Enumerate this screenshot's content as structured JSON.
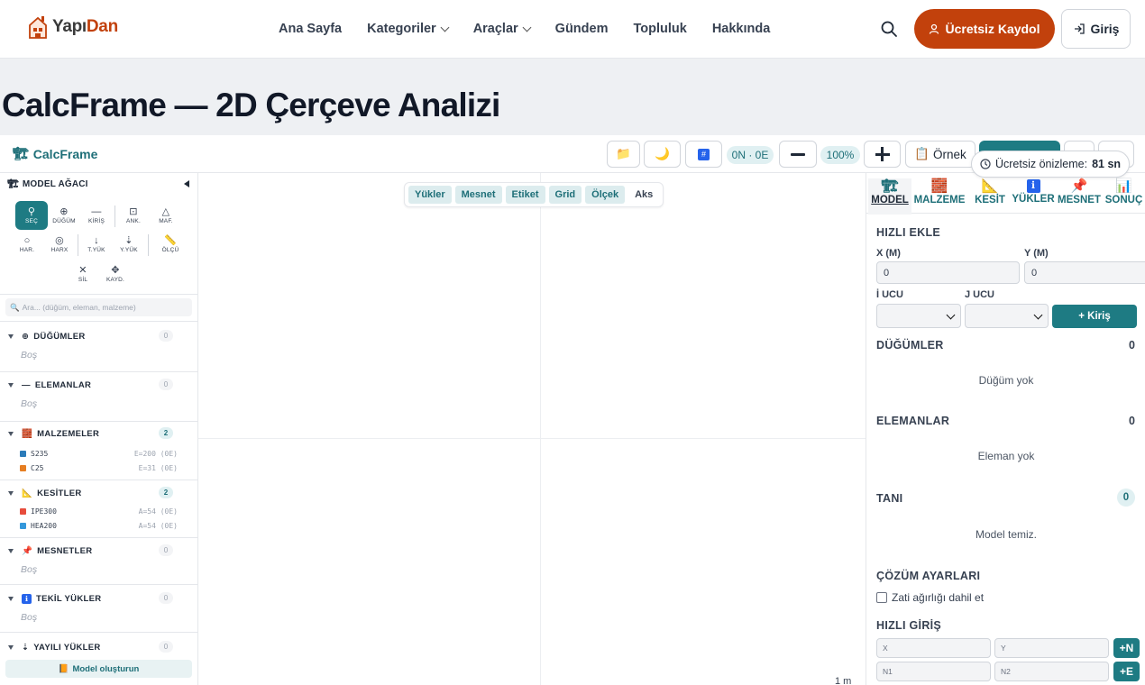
{
  "brand": {
    "name_a": "Yapı",
    "name_b": "Dan"
  },
  "nav": {
    "items": [
      "Ana Sayfa",
      "Kategoriler",
      "Araçlar",
      "Gündem",
      "Topluluk",
      "Hakkında"
    ],
    "register": "Ücretsiz Kaydol",
    "login": "Giriş"
  },
  "page": {
    "title": "CalcFrame — 2D Çerçeve Analizi"
  },
  "toolbar": {
    "app_name": "CalcFrame",
    "counts": "0N · 0E",
    "zoom": "100%",
    "example": "Örnek",
    "preview": "Ücretsiz önizleme:",
    "preview_time": "81 sn"
  },
  "left": {
    "title": "MODEL AĞACI",
    "tools_row1": [
      {
        "label": "SEÇ",
        "icon": "⚲"
      },
      {
        "label": "DÜĞÜM",
        "icon": "⊕"
      },
      {
        "label": "KİRİŞ",
        "icon": "—"
      },
      {
        "label": "ANK.",
        "icon": "⊡"
      },
      {
        "label": "MAF.",
        "icon": "△"
      }
    ],
    "tools_row2": [
      {
        "label": "HAR.",
        "icon": "○"
      },
      {
        "label": "HARX",
        "icon": "◎"
      },
      {
        "label": "T.YÜK",
        "icon": "↓"
      },
      {
        "label": "Y.YÜK",
        "icon": "⇣"
      },
      {
        "label": "ÖLÇÜ",
        "icon": "📏"
      }
    ],
    "tools_row3": [
      {
        "label": "SİL",
        "icon": "✕"
      },
      {
        "label": "KAYD.",
        "icon": "✥"
      }
    ],
    "search_placeholder": "Ara... (düğüm, eleman, malzeme)",
    "sections": [
      {
        "title": "DÜĞÜMLER",
        "icon": "⊕",
        "count": "0",
        "empty": "Boş"
      },
      {
        "title": "ELEMANLAR",
        "icon": "—",
        "count": "0",
        "empty": "Boş"
      },
      {
        "title": "MALZEMELER",
        "icon": "🧱",
        "count": "2",
        "rows": [
          {
            "name": "S235",
            "meta": "E=200 (0E)",
            "color": "#2b7bb9"
          },
          {
            "name": "C25",
            "meta": "E=31 (0E)",
            "color": "#e67e22"
          }
        ]
      },
      {
        "title": "KESİTLER",
        "icon": "📐",
        "count": "2",
        "rows": [
          {
            "name": "IPE300",
            "meta": "A=54 (0E)",
            "color": "#e74c3c"
          },
          {
            "name": "HEA200",
            "meta": "A=54 (0E)",
            "color": "#3498db"
          }
        ]
      },
      {
        "title": "MESNETLER",
        "icon": "📌",
        "count": "0",
        "empty": "Boş"
      },
      {
        "title": "TEKİL YÜKLER",
        "icon": "ℹ",
        "count": "0",
        "empty": "Boş"
      },
      {
        "title": "YAYILI YÜKLER",
        "icon": "⇣",
        "count": "0"
      }
    ],
    "model_button": "Model oluşturun"
  },
  "canvas": {
    "layers": [
      {
        "label": "Yükler",
        "on": true
      },
      {
        "label": "Mesnet",
        "on": true
      },
      {
        "label": "Etiket",
        "on": true
      },
      {
        "label": "Grid",
        "on": true
      },
      {
        "label": "Ölçek",
        "on": true
      },
      {
        "label": "Aks",
        "on": false
      }
    ],
    "scale": "1 m"
  },
  "right": {
    "tabs": [
      {
        "label": "MODEL",
        "icon": "🏗"
      },
      {
        "label": "MALZEME",
        "icon": "🧱"
      },
      {
        "label": "KESİT",
        "icon": "📐"
      },
      {
        "label": "YÜKLER",
        "icon": "ℹ"
      },
      {
        "label": "MESNET",
        "icon": "📌"
      },
      {
        "label": "SONUÇ",
        "icon": "📊"
      }
    ],
    "quick_add": "HIZLI EKLE",
    "x_label": "X (M)",
    "y_label": "Y (M)",
    "x_value": "0",
    "y_value": "0",
    "i_label": "İ UCU",
    "j_label": "J UCU",
    "add_beam": "+ Kiriş",
    "nodes_title": "DÜĞÜMLER",
    "nodes_count": "0",
    "nodes_empty": "Düğüm yok",
    "elems_title": "ELEMANLAR",
    "elems_count": "0",
    "elems_empty": "Eleman yok",
    "diag_title": "TANI",
    "diag_count": "0",
    "diag_empty": "Model temiz.",
    "solve_title": "ÇÖZÜM AYARLARI",
    "self_weight": "Zati ağırlığı dahil et",
    "quick_input": "HIZLI GİRİŞ",
    "q_x": "X",
    "q_y": "Y",
    "q_n1": "N1",
    "q_n2": "N2",
    "add_node": "+N",
    "add_elem": "+E"
  }
}
